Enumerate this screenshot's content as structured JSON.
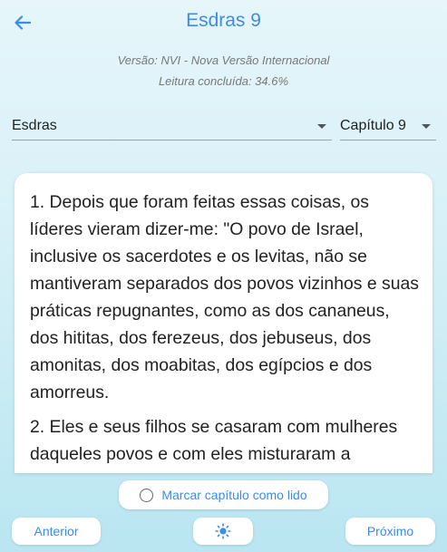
{
  "header": {
    "title": "Esdras 9",
    "back_icon": "arrow-left-icon"
  },
  "meta": {
    "version": "Versão: NVI - Nova Versão Internacional",
    "progress": "Leitura concluída: 34.6%"
  },
  "selectors": {
    "book": "Esdras",
    "chapter": "Capítulo 9"
  },
  "verses": [
    "1. Depois que foram feitas essas coisas, os líderes vieram dizer-me: \"O povo de Israel, inclusive os sacerdotes e os levitas, não se mantiveram separados dos povos vizinhos e suas práticas repugnantes, como as dos cananeus, dos hititas, dos ferezeus, dos jebuseus, dos amonitas, dos moabitas, dos egípcios e dos amorreus.",
    "2. Eles e seus filhos se casaram com mulheres daqueles povos e com eles misturaram a"
  ],
  "actions": {
    "mark_read": "Marcar capítulo como lido",
    "previous": "Anterior",
    "next": "Próximo",
    "theme_icon": "sun-icon"
  },
  "colors": {
    "accent": "#3d8bea"
  }
}
